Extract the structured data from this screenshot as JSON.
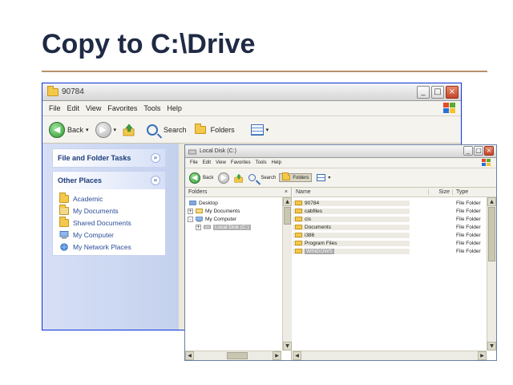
{
  "slide": {
    "title": "Copy to C:\\Drive"
  },
  "back_window": {
    "title": "90784",
    "menu": [
      "File",
      "Edit",
      "View",
      "Favorites",
      "Tools",
      "Help"
    ],
    "toolbar": {
      "back": "Back",
      "search": "Search",
      "folders": "Folders"
    },
    "tasks_panel": {
      "title": "File and Folder Tasks",
      "toggle": "»"
    },
    "other_places": {
      "title": "Other Places",
      "toggle": "«",
      "items": [
        {
          "label": "Academic",
          "icon": "folder-icon"
        },
        {
          "label": "My Documents",
          "icon": "my-documents-icon"
        },
        {
          "label": "Shared Documents",
          "icon": "folder-icon"
        },
        {
          "label": "My Computer",
          "icon": "my-computer-icon"
        },
        {
          "label": "My Network Places",
          "icon": "network-places-icon"
        }
      ]
    }
  },
  "front_window": {
    "title": "Local Disk (C:)",
    "menu": [
      "File",
      "Edit",
      "View",
      "Favorites",
      "Tools",
      "Help"
    ],
    "toolbar": {
      "back": "Back",
      "search": "Search",
      "folders": "Folders"
    },
    "folders_pane": {
      "header": "Folders",
      "close": "×",
      "tree": [
        {
          "label": "Desktop",
          "expander": ""
        },
        {
          "label": "My Documents",
          "expander": "+"
        },
        {
          "label": "My Computer",
          "expander": "-"
        },
        {
          "label": "Local Disk (C:)",
          "expander": "+"
        }
      ]
    },
    "files_pane": {
      "columns": {
        "name": "Name",
        "size": "Size",
        "type": "Type"
      },
      "rows": [
        {
          "name": "90784",
          "type": "File Folder"
        },
        {
          "name": "cabfiles",
          "type": "File Folder"
        },
        {
          "name": "cis",
          "type": "File Folder"
        },
        {
          "name": "Documents",
          "type": "File Folder"
        },
        {
          "name": "i386",
          "type": "File Folder"
        },
        {
          "name": "Program Files",
          "type": "File Folder"
        },
        {
          "name": "WINDOWS",
          "type": "File Folder"
        }
      ]
    }
  },
  "colors": {
    "title_text": "#1f2a44",
    "title_rule": "#b8906a",
    "xp_blue": "#0831d9",
    "link_blue": "#2b4d9a"
  }
}
